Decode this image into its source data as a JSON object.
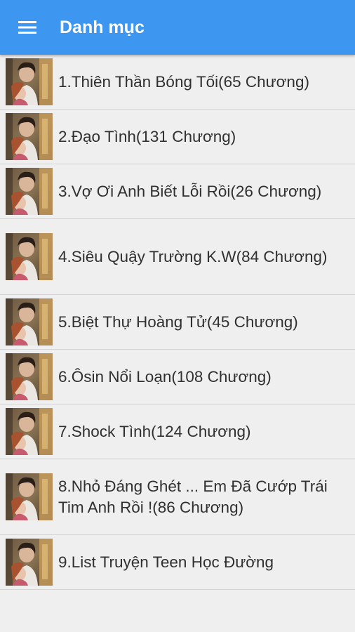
{
  "header": {
    "title": "Danh mục",
    "menu_icon": "hamburger-menu-icon",
    "color": "#3d97f0"
  },
  "list": {
    "items": [
      {
        "label": "1.Thiên Thần Bóng Tối(65 Chương)"
      },
      {
        "label": "2.Đạo Tình(131 Chương)"
      },
      {
        "label": "3.Vợ Ơi Anh Biết Lỗi Rồi(26 Chương)"
      },
      {
        "label": "4.Siêu Quậy Trường K.W(84 Chương)"
      },
      {
        "label": "5.Biệt Thự Hoàng Tử(45 Chương)"
      },
      {
        "label": "6.Ôsin Nổi Loạn(108 Chương)"
      },
      {
        "label": "7.Shock Tình(124 Chương)"
      },
      {
        "label": "8.Nhỏ Đáng Ghét ... Em Đã Cướp Trái Tim Anh Rồi !(86 Chương)"
      },
      {
        "label": "9.List Truyện Teen Học Đường"
      }
    ]
  }
}
